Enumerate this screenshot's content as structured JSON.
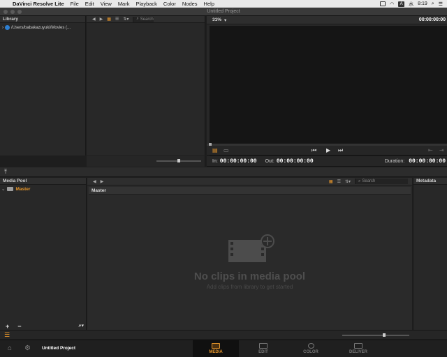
{
  "menubar": {
    "app_name": "DaVinci Resolve Lite",
    "items": [
      "File",
      "Edit",
      "View",
      "Mark",
      "Playback",
      "Color",
      "Nodes",
      "Help"
    ],
    "lang_badge": "A",
    "day": "水",
    "time": "8:19"
  },
  "window": {
    "title": "Untitled Project"
  },
  "library": {
    "title": "Library",
    "path": "/Users/babakazuyuki/Movies (...",
    "search_placeholder": "Search"
  },
  "viewer": {
    "zoom": "31%",
    "timecode": "00:00:00:00",
    "in_label": "In:",
    "in_value": "00:00:00:00",
    "out_label": "Out:",
    "out_value": "00:00:00:00",
    "duration_label": "Duration:",
    "duration_value": "00:00:00:00"
  },
  "media_pool": {
    "title": "Media Pool",
    "master_label": "Master",
    "bin_header": "Master",
    "search_placeholder": "Search",
    "empty_title": "No clips in media pool",
    "empty_subtitle": "Add clips from library to get started",
    "add_label": "+",
    "remove_label": "−"
  },
  "metadata": {
    "title": "Metadata"
  },
  "pagebar": {
    "project_name": "Untitled Project",
    "pages": [
      "MEDIA",
      "EDIT",
      "COLOR",
      "DELIVER"
    ],
    "active_page": "MEDIA"
  },
  "colors": {
    "accent": "#e8972b",
    "background": "#282828"
  }
}
